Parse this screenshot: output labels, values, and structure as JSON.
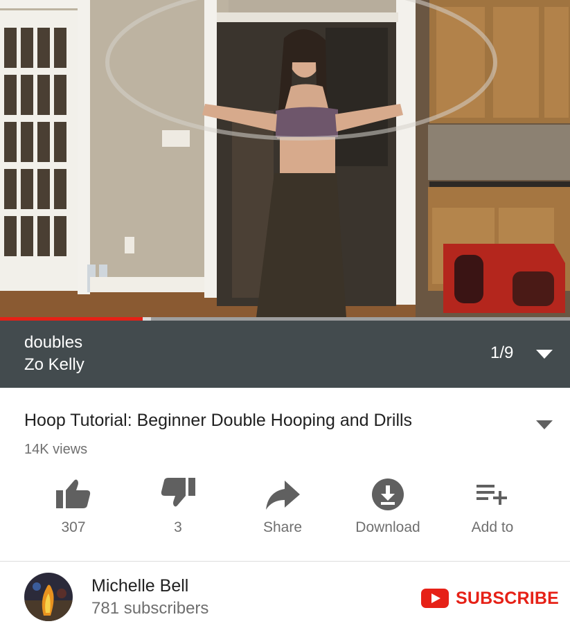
{
  "player": {
    "progress_fraction": 0.25,
    "buffered_fraction": 0.265
  },
  "playlist": {
    "title": "doubles",
    "owner": "Zo Kelly",
    "position": "1/9"
  },
  "video": {
    "title": "Hoop Tutorial: Beginner Double Hooping and Drills",
    "views": "14K views"
  },
  "actions": [
    {
      "label": "307",
      "icon": "thumbs-up-icon"
    },
    {
      "label": "3",
      "icon": "thumbs-down-icon"
    },
    {
      "label": "Share",
      "icon": "share-icon"
    },
    {
      "label": "Download",
      "icon": "download-icon"
    },
    {
      "label": "Add to",
      "icon": "playlist-add-icon"
    }
  ],
  "channel": {
    "name": "Michelle Bell",
    "subscribers": "781 subscribers",
    "subscribe_label": "SUBSCRIBE"
  },
  "colors": {
    "accent": "#e62117",
    "playlist_bar": "#434b4e",
    "icon_gray": "#606060"
  }
}
